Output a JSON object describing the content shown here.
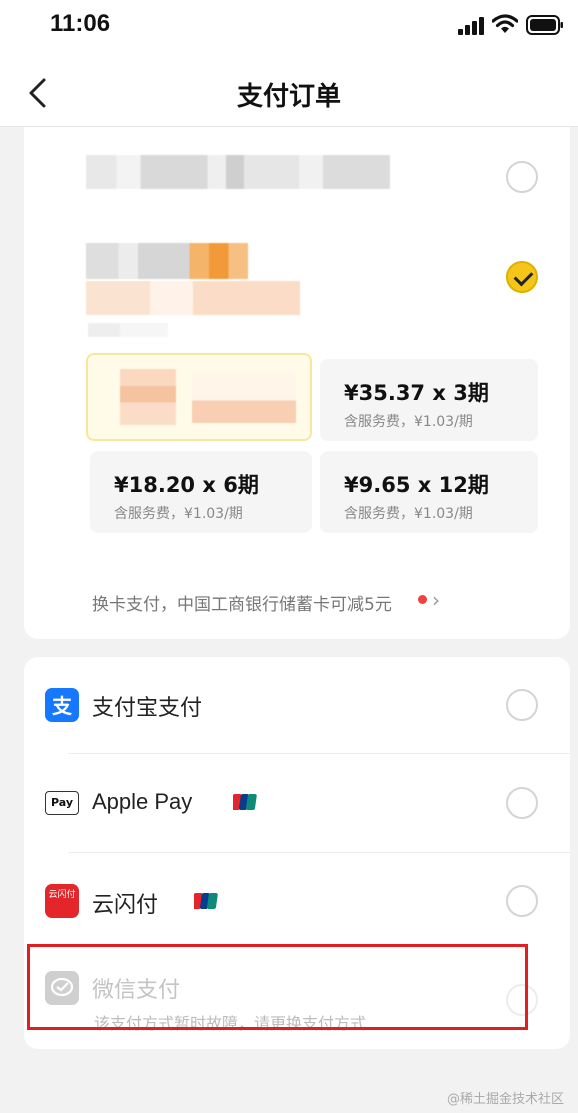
{
  "status_bar": {
    "time": "11:06"
  },
  "nav": {
    "title": "支付订单"
  },
  "installments": {
    "options": [
      {
        "amount": "¥35.37 x 3期",
        "fee": "含服务费，¥1.03/期"
      },
      {
        "amount": "¥18.20 x 6期",
        "fee": "含服务费，¥1.03/期"
      },
      {
        "amount": "¥9.65 x 12期",
        "fee": "含服务费，¥1.03/期"
      }
    ],
    "hint": "换卡支付，中国工商银行储蓄卡可减5元",
    "chevron": "›"
  },
  "payment_methods": [
    {
      "label": "支付宝支付"
    },
    {
      "label": "Apple Pay",
      "badge": "Pay"
    },
    {
      "label": "云闪付",
      "badge": "云闪付"
    },
    {
      "label": "微信支付",
      "subtitle": "该支付方式暂时故障，请更换支付方式"
    }
  ],
  "watermark": "@稀土掘金技术社区",
  "colors": {
    "accent": "#f5c518",
    "alipay": "#1677ff",
    "unionpay_red": "#e4262b",
    "highlight": "#e02020"
  }
}
